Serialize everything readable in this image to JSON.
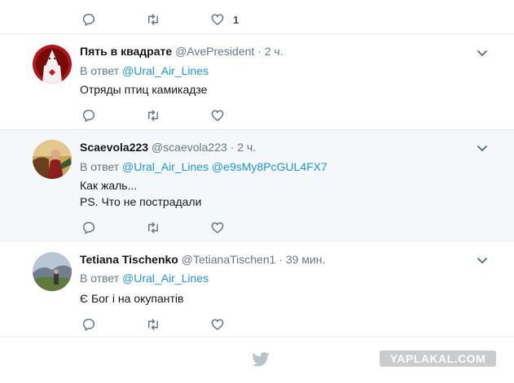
{
  "top": {
    "like_count": "1"
  },
  "tweets": [
    {
      "name": "Пять в квадрате",
      "handle": "@AvePresident",
      "dot": "·",
      "time": "2 ч.",
      "reply_prefix": "В ответ",
      "mentions": [
        "@Ural_Air_Lines"
      ],
      "lines": [
        "Отряды птиц камикадзе"
      ],
      "highlighted": false
    },
    {
      "name": "Scaevola223",
      "handle": "@scaevola223",
      "dot": "·",
      "time": "2 ч.",
      "reply_prefix": "В ответ",
      "mentions": [
        "@Ural_Air_Lines",
        "@e9sMy8PcGUL4FX7"
      ],
      "lines": [
        "Как жаль...",
        "PS. Что не пострадали"
      ],
      "highlighted": true
    },
    {
      "name": "Tetiana Tischenko",
      "handle": "@TetianaTischen1",
      "dot": "·",
      "time": "39 мин.",
      "reply_prefix": "В ответ",
      "mentions": [
        "@Ural_Air_Lines"
      ],
      "lines": [
        "Є Бог і на окупантів"
      ],
      "highlighted": false
    }
  ],
  "watermark": "YAPLAKAL.COM",
  "colors": {
    "link": "#1b95e0",
    "muted": "#657786",
    "highlight_bg": "#f5f8fa",
    "border": "#e6ecf0"
  }
}
